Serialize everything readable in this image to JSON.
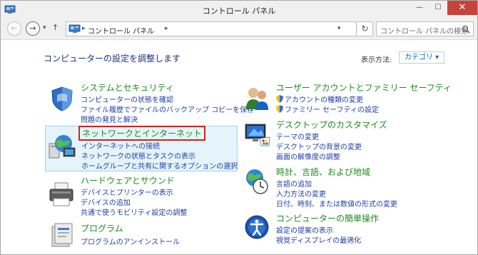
{
  "window": {
    "title": "コントロール パネル",
    "minimize_label": "—",
    "maximize_label": "☐",
    "close_label": "✕"
  },
  "nav": {
    "back_label": "←",
    "forward_label": "→",
    "recent_label": "▾",
    "up_label": "↑",
    "address": "コントロール パネル",
    "address_sep": "▸",
    "address_sep2": "▸",
    "address_dropdown": "▾",
    "refresh_label": "↻",
    "search_placeholder": "コントロール パネルの検索"
  },
  "main": {
    "heading": "コンピューターの設定を調整します",
    "view_by_label": "表示方法:",
    "view_by_value": "カテゴリ ▾"
  },
  "categories": [
    {
      "title": "システムとセキュリティ",
      "icon": "shield-flag-icon",
      "links": [
        "コンピューターの状態を確認",
        "ファイル履歴でファイルのバックアップ コピーを保存",
        "問題の発見と解決"
      ]
    },
    {
      "title": "ネットワークとインターネット",
      "icon": "network-globe-icon",
      "links": [
        "インターネットへの接続",
        "ネットワークの状態とタスクの表示",
        "ホームグループと共有に関するオプションの選択"
      ]
    },
    {
      "title": "ハードウェアとサウンド",
      "icon": "printer-icon",
      "links": [
        "デバイスとプリンターの表示",
        "デバイスの追加",
        "共通で使うモビリティ設定の調整"
      ]
    },
    {
      "title": "プログラム",
      "icon": "programs-icon",
      "links": [
        "プログラムのアンインストール"
      ]
    },
    {
      "title": "ユーザー アカウントとファミリー セーフティ",
      "icon": "users-icon",
      "links": [
        "アカウントの種類の変更",
        "ファミリー セーフティの設定"
      ]
    },
    {
      "title": "デスクトップのカスタマイズ",
      "icon": "monitor-palette-icon",
      "links": [
        "テーマの変更",
        "デスクトップの背景の変更",
        "画面の解像度の調整"
      ]
    },
    {
      "title": "時計、言語、および地域",
      "icon": "clock-globe-icon",
      "links": [
        "言語の追加",
        "入力方法の変更",
        "日付、時刻、または数値の形式の変更"
      ]
    },
    {
      "title": "コンピューターの簡単操作",
      "icon": "ease-of-access-icon",
      "links": [
        "設定の提案の表示",
        "視覚ディスプレイの最適化"
      ]
    }
  ],
  "colors": {
    "category_title": "#1b8d1b",
    "link": "#1f3fa5",
    "heading": "#1e3287",
    "highlight_bg": "#e5f3fb",
    "highlight_border": "#9fd4ec",
    "selection_box": "#d22121",
    "close_button": "#c7443a"
  }
}
